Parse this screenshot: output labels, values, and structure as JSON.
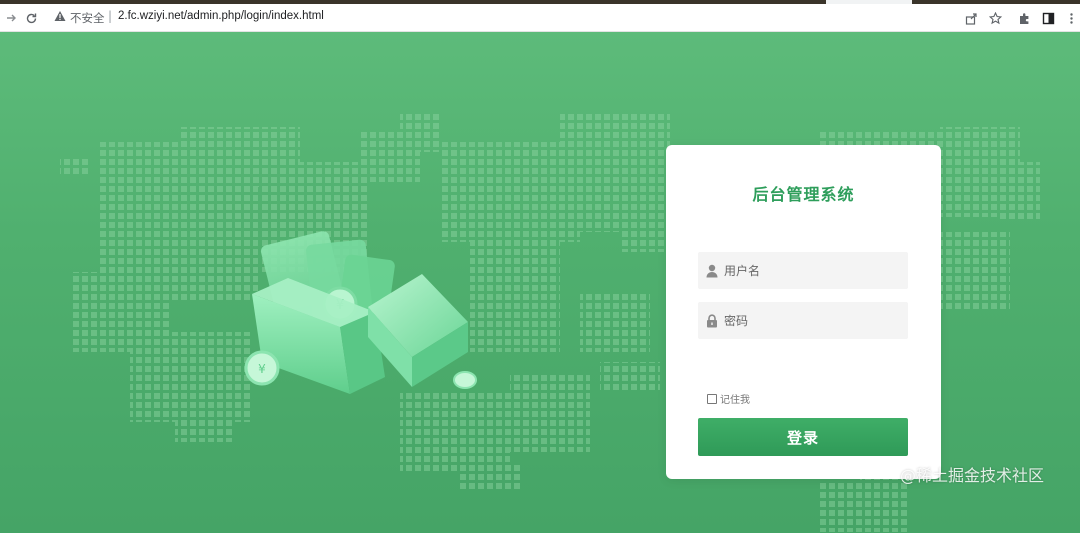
{
  "browser": {
    "security_label": "不安全",
    "url": "2.fc.wziyi.net/admin.php/login/index.html"
  },
  "login": {
    "title": "后台管理系统",
    "username_placeholder": "用户名",
    "password_placeholder": "密码",
    "remember_label": "记住我",
    "submit_label": "登录"
  },
  "watermark": "@稀土掘金技术社区",
  "colors": {
    "background": "#4cae6d",
    "accent": "#2e9e5b",
    "card": "#ffffff",
    "field": "#f4f4f4"
  },
  "icons": {
    "back": "arrow-right-icon",
    "reload": "reload-icon",
    "warning": "warning-icon",
    "share": "share-icon",
    "bookmark": "star-icon",
    "extensions": "puzzle-icon",
    "sidepanel": "side-panel-icon",
    "menu": "more-vertical-icon",
    "user": "user-icon",
    "lock": "lock-icon"
  }
}
